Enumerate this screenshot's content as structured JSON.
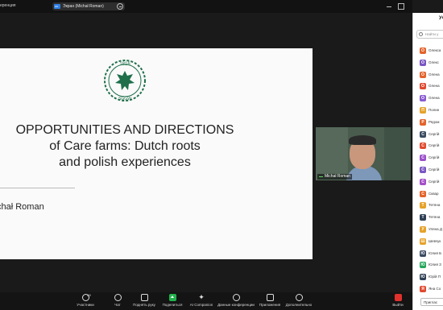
{
  "topbar": {
    "app_title": "еренция",
    "share_tag": "HD",
    "share_label": "Экран (Michał Roman)"
  },
  "slide": {
    "seal_year": "1816",
    "seal_initials": "SGGW",
    "title_lines": [
      "OPPORTUNITIES AND DIRECTIONS",
      "of Care farms: Dutch roots",
      "and polish experiences"
    ],
    "author": "chał Roman"
  },
  "video": {
    "participant_name": "Michał Roman"
  },
  "participants_panel": {
    "title": "Уч",
    "search_placeholder": "Найти у",
    "invite_label": "Приглас",
    "people": [
      {
        "initial": "О",
        "name": "Олекса",
        "color": "#e3632b"
      },
      {
        "initial": "О",
        "name": "Олекс",
        "color": "#7a56c2"
      },
      {
        "initial": "О",
        "name": "Олена",
        "color": "#e3632b"
      },
      {
        "initial": "О",
        "name": "Олена",
        "color": "#e04a2f"
      },
      {
        "initial": "О",
        "name": "Олена",
        "color": "#8a5bd0"
      },
      {
        "initial": "П",
        "name": "Полин",
        "color": "#e6a22a"
      },
      {
        "initial": "Р",
        "name": "Рядом",
        "color": "#e3632b"
      },
      {
        "initial": "С",
        "name": "Сергій",
        "color": "#3a4a60"
      },
      {
        "initial": "С",
        "name": "Сергій",
        "color": "#e04a2f"
      },
      {
        "initial": "С",
        "name": "Сергій",
        "color": "#9b4fc9"
      },
      {
        "initial": "С",
        "name": "Сергій",
        "color": "#7a56c2"
      },
      {
        "initial": "С",
        "name": "Сергій",
        "color": "#a34fc9"
      },
      {
        "initial": "С",
        "name": "Сквар",
        "color": "#e3632b"
      },
      {
        "initial": "Т",
        "name": "Тетяна",
        "color": "#e6a22a"
      },
      {
        "initial": "Т",
        "name": "Тетяна",
        "color": "#2f3f55"
      },
      {
        "initial": "У",
        "name": "Уляна Д",
        "color": "#e6a22a"
      },
      {
        "initial": "Ш",
        "name": "Шевчук",
        "color": "#e6a22a"
      },
      {
        "initial": "Ю",
        "name": "Юлия Б",
        "color": "#3a4a60"
      },
      {
        "initial": "Ю",
        "name": "Юлия З",
        "color": "#26a65b"
      },
      {
        "initial": "Ю",
        "name": "Юрій П",
        "color": "#2f3f55"
      },
      {
        "initial": "Я",
        "name": "Яна Со",
        "color": "#e04a2f"
      }
    ]
  },
  "toolbar": {
    "participants_count": "69",
    "items": [
      {
        "label": "Участники"
      },
      {
        "label": "Чат"
      },
      {
        "label": "Поднять руку"
      },
      {
        "label": "Поделиться"
      },
      {
        "label": "AI Companion"
      },
      {
        "label": "Данные конференции"
      },
      {
        "label": "Приложения"
      },
      {
        "label": "Дополнительно"
      },
      {
        "label": "Выйти"
      }
    ]
  }
}
